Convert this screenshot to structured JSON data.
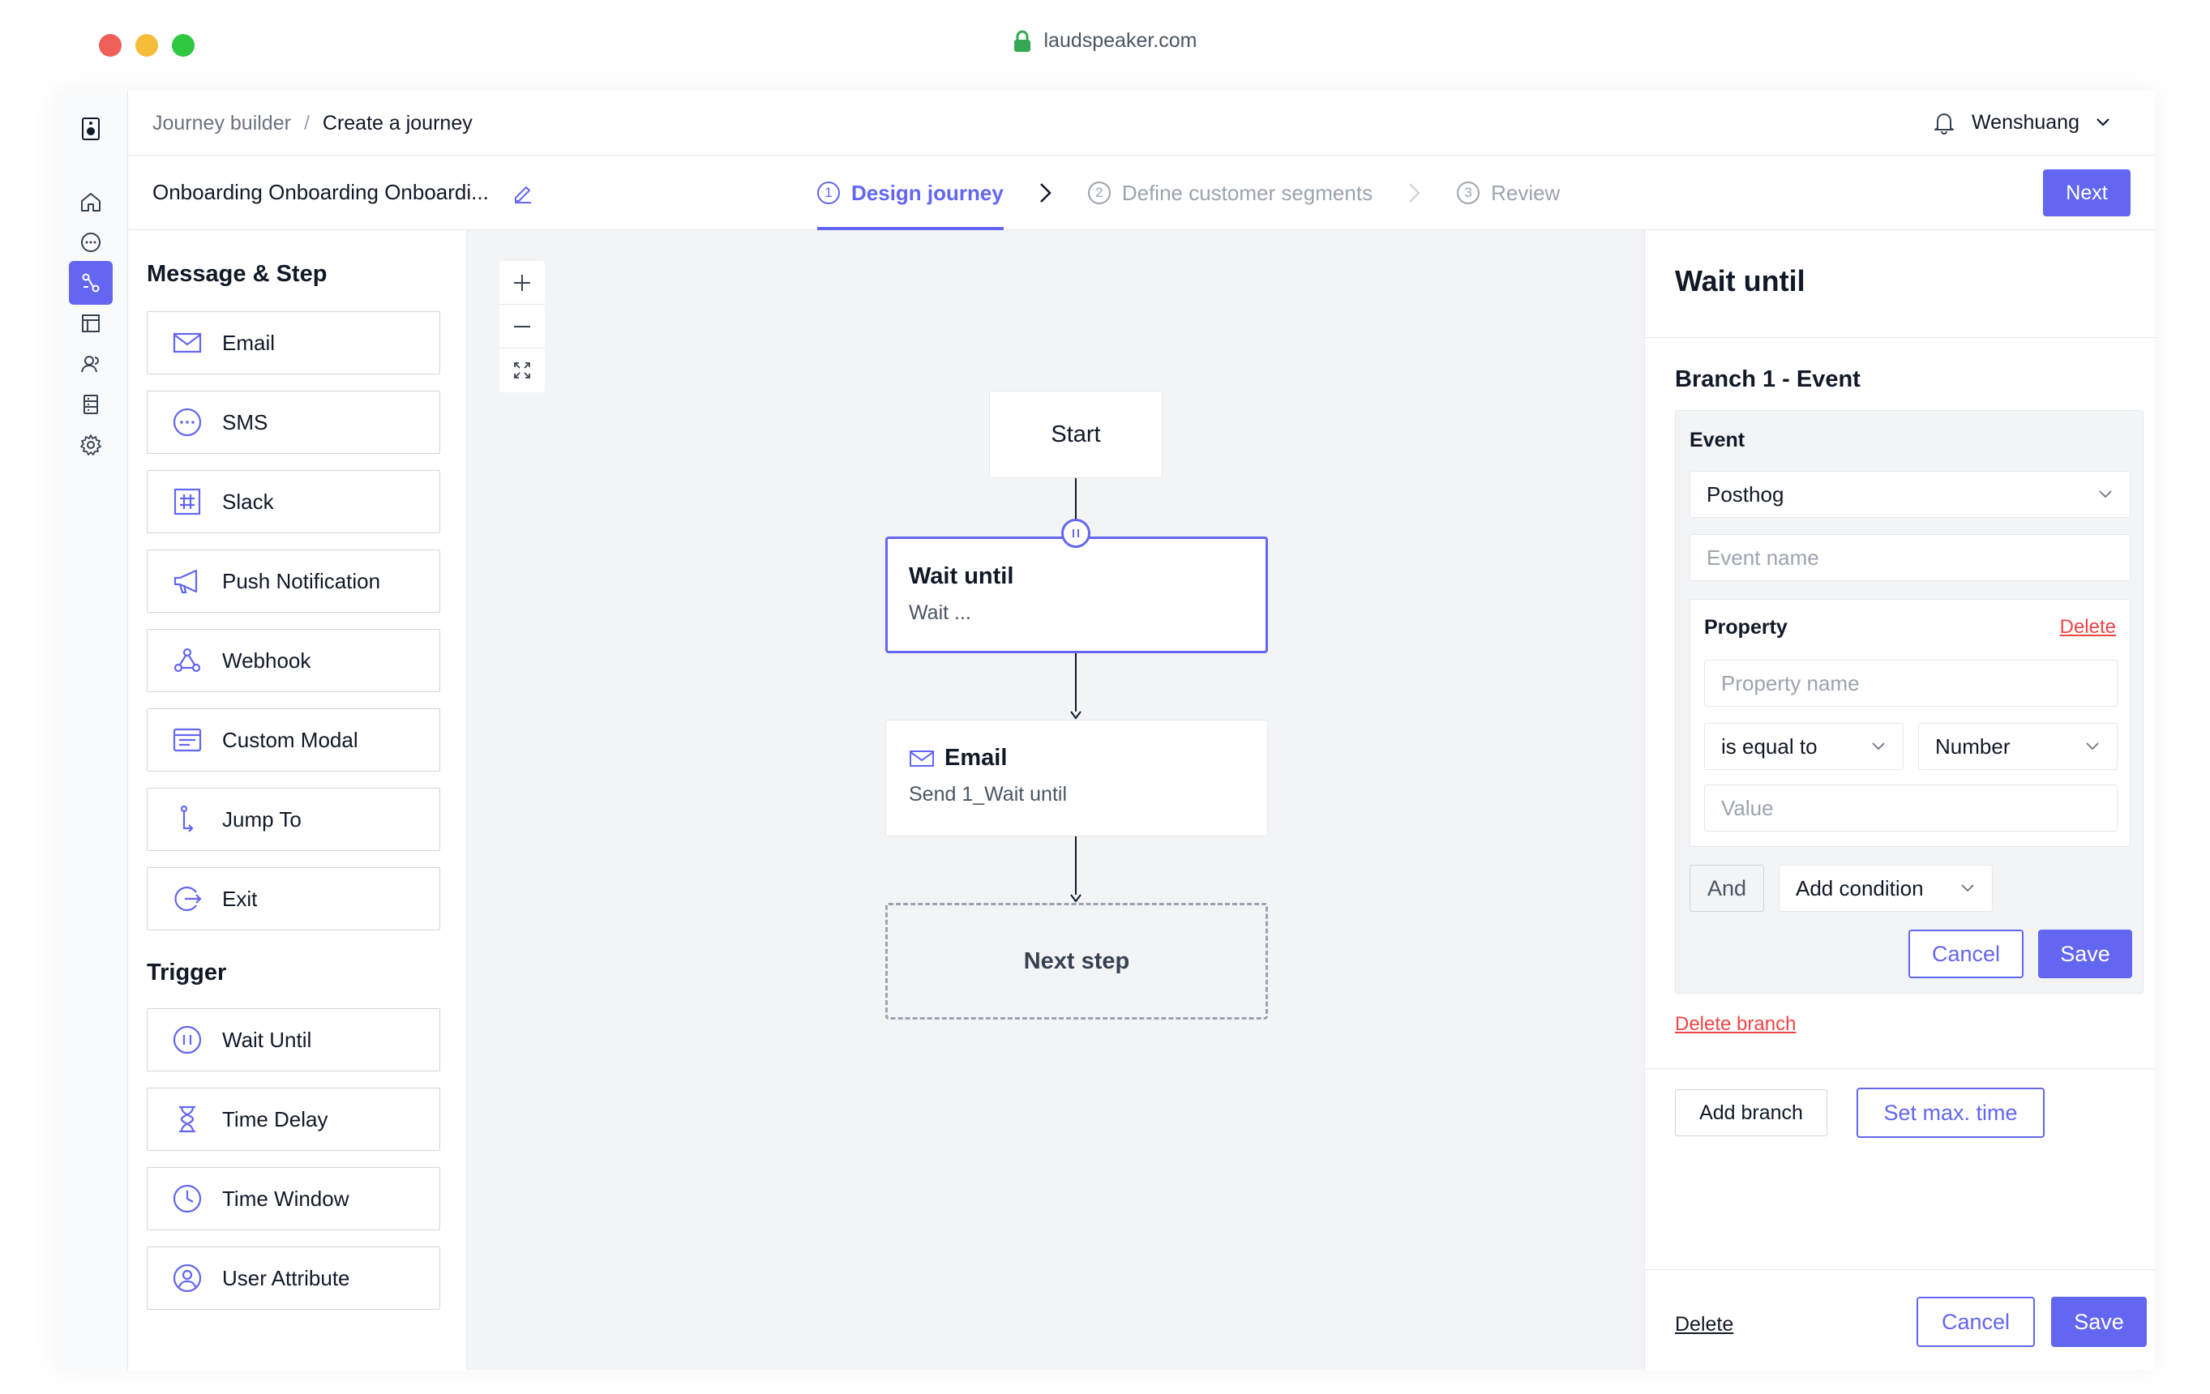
{
  "browser": {
    "url": "laudspeaker.com"
  },
  "breadcrumb": {
    "parent": "Journey builder",
    "separator": "/",
    "current": "Create a journey"
  },
  "user": {
    "name": "Wenshuang"
  },
  "journey": {
    "title": "Onboarding Onboarding Onboardi..."
  },
  "steps": [
    {
      "num": "1",
      "label": "Design journey",
      "active": true
    },
    {
      "num": "2",
      "label": "Define customer segments",
      "active": false
    },
    {
      "num": "3",
      "label": "Review",
      "active": false
    }
  ],
  "next_label": "Next",
  "palette": {
    "message_heading": "Message & Step",
    "message_items": [
      {
        "label": "Email",
        "icon": "email-icon"
      },
      {
        "label": "SMS",
        "icon": "sms-icon"
      },
      {
        "label": "Slack",
        "icon": "slack-icon"
      },
      {
        "label": "Push Notification",
        "icon": "megaphone-icon"
      },
      {
        "label": "Webhook",
        "icon": "webhook-icon"
      },
      {
        "label": "Custom Modal",
        "icon": "modal-icon"
      },
      {
        "label": "Jump To",
        "icon": "jump-icon"
      },
      {
        "label": "Exit",
        "icon": "exit-icon"
      }
    ],
    "trigger_heading": "Trigger",
    "trigger_items": [
      {
        "label": "Wait Until",
        "icon": "pause-icon"
      },
      {
        "label": "Time Delay",
        "icon": "hourglass-icon"
      },
      {
        "label": "Time Window",
        "icon": "clock-icon"
      },
      {
        "label": "User Attribute",
        "icon": "user-icon"
      }
    ]
  },
  "flow": {
    "start": "Start",
    "wait": {
      "title": "Wait until",
      "subtitle": "Wait ..."
    },
    "email": {
      "title": "Email",
      "subtitle": "Send 1_Wait until"
    },
    "next": "Next step"
  },
  "panel": {
    "title": "Wait until",
    "branch_title": "Branch 1 - Event",
    "event_label": "Event",
    "event_source": "Posthog",
    "event_name_placeholder": "Event name",
    "property_label": "Property",
    "property_delete": "Delete",
    "property_name_placeholder": "Property name",
    "operator": "is equal to",
    "value_type": "Number",
    "value_placeholder": "Value",
    "and_label": "And",
    "add_condition": "Add condition",
    "cancel": "Cancel",
    "save": "Save",
    "delete_branch": "Delete branch",
    "add_branch": "Add branch",
    "set_max_time": "Set max. time",
    "footer_delete": "Delete",
    "footer_cancel": "Cancel",
    "footer_save": "Save"
  },
  "colors": {
    "accent": "#6366f1",
    "danger": "#ef4444",
    "canvas": "#f3f4f6"
  }
}
